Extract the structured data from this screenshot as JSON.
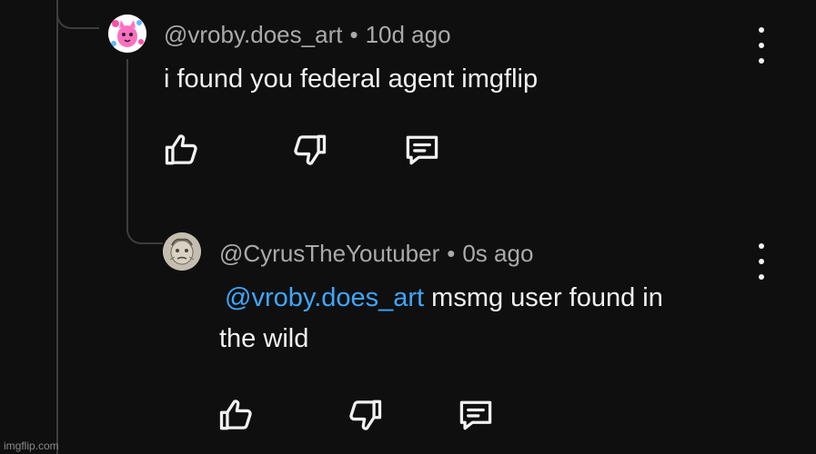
{
  "comment": {
    "author": "@vroby.does_art",
    "separator": "•",
    "time": "10d ago",
    "text": "i found you federal agent imgflip"
  },
  "reply": {
    "author": "@CyrusTheYoutuber",
    "separator": "•",
    "time": "0s ago",
    "mention": "@vroby.does_art",
    "text_line1": " msmg user found in",
    "text_line2": "the wild"
  },
  "icons": {
    "like": "thumbs-up-icon",
    "dislike": "thumbs-down-icon",
    "reply": "reply-comment-icon",
    "menu": "more-vertical-icon"
  },
  "colors": {
    "background": "#0f0f0f",
    "text": "#f1f1f1",
    "meta": "#aaaaaa",
    "mention": "#3ea6ff"
  },
  "watermark": "imgflip.com"
}
